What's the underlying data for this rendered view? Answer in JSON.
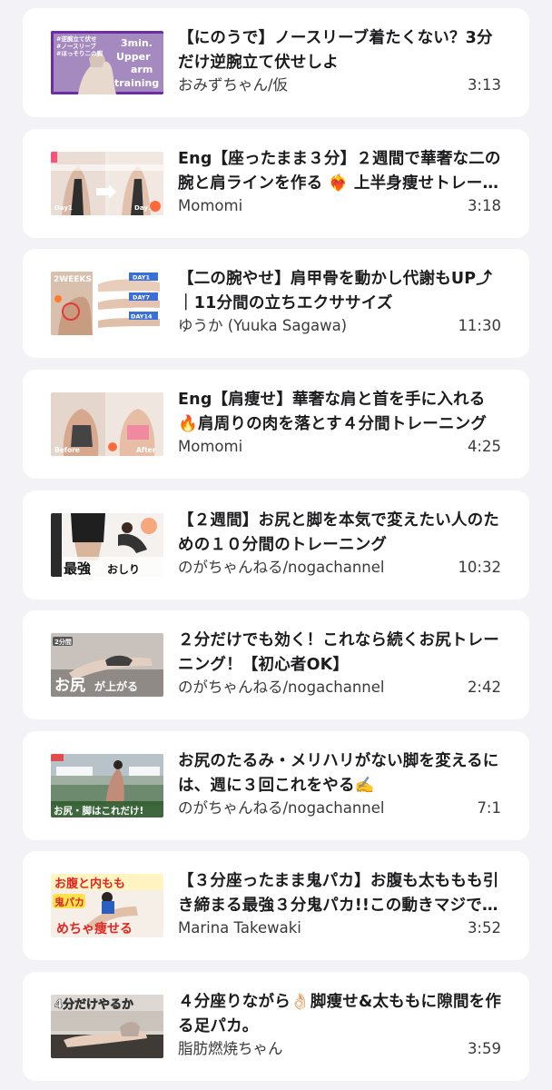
{
  "videos": [
    {
      "title": "【にのうで】ノースリーブ着たくない？3分だけ逆腕立て伏せしよ",
      "channel": "おみずちゃん/仮",
      "duration": "3:13",
      "thumb_text": [
        "3min.",
        "Upper",
        "arm",
        "training"
      ],
      "thumb_tags": [
        "#逆腕立て伏せ",
        "#ノースリーブ",
        "#ほっそり二の腕"
      ]
    },
    {
      "title": "Eng【座ったまま３分】２週間で華奢な二の腕と肩ラインを作る ❤️‍🔥 上半身痩せトレーニング",
      "channel": "Momomi",
      "duration": "3:18",
      "thumb_text": [
        "Day1",
        "Day14"
      ]
    },
    {
      "title": "【二の腕やせ】肩甲骨を動かし代謝もUP⤴︎｜11分間の立ちエクササイズ",
      "channel": "ゆうか (Yuuka Sagawa)",
      "duration": "11:30",
      "thumb_text": [
        "2WEEKS",
        "DAY1",
        "DAY7",
        "DAY14"
      ]
    },
    {
      "title": "Eng【肩痩せ】華奢な肩と首を手に入れる🔥肩周りの肉を落とす４分間トレーニング",
      "channel": "Momomi",
      "duration": "4:25",
      "thumb_text": [
        "Before",
        "After"
      ]
    },
    {
      "title": "【２週間】お尻と脚を本気で変えたい人のための１０分間のトレーニング",
      "channel": "のがちゃんねる/nogachannel",
      "duration": "10:32",
      "thumb_text": [
        "最強",
        "おしり"
      ]
    },
    {
      "title": "２分だけでも効く！これなら続くお尻トレーニング！【初心者OK】",
      "channel": "のがちゃんねる/nogachannel",
      "duration": "2:42",
      "thumb_text": [
        "2分間",
        "お尻",
        "が上がる"
      ]
    },
    {
      "title": "お尻のたるみ・メリハリがない脚を変えるには、週に３回これをやる✍️",
      "channel": "のがちゃんねる/nogachannel",
      "duration": "7:1",
      "thumb_text": [
        "お尻・脚はこれだけ!"
      ]
    },
    {
      "title": "【３分座ったまま鬼パカ】お腹も太ももも引き締まる最強３分鬼パカ!!この動きマジで効く",
      "channel": "Marina Takewaki",
      "duration": "3:52",
      "thumb_text": [
        "お腹と内もも",
        "鬼パカ",
        "めちゃ痩せる"
      ]
    },
    {
      "title": "４分座りながら👌🏻脚痩せ&太ももに隙間を作る足パカ。",
      "channel": "脂肪燃焼ちゃん",
      "duration": "3:59",
      "thumb_text": [
        "4分だけやるか"
      ]
    }
  ]
}
